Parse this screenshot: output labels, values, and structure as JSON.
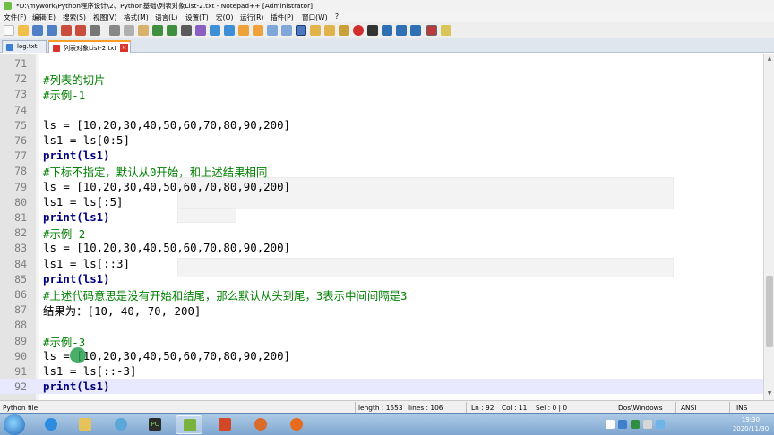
{
  "window": {
    "title": "*D:\\mywork\\Python程序设计\\2、Python基础\\列表对象List-2.txt - Notepad++ [Administrator]"
  },
  "menu": [
    "文件(F)",
    "编辑(E)",
    "搜索(S)",
    "视图(V)",
    "格式(M)",
    "语言(L)",
    "设置(T)",
    "宏(O)",
    "运行(R)",
    "插件(P)",
    "窗口(W)",
    "?"
  ],
  "tabs": [
    {
      "label": "log.txt",
      "active": false,
      "icon_color": "#3d7fd6"
    },
    {
      "label": "列表对象List-2.txt",
      "active": true,
      "icon_color": "#d9342b"
    }
  ],
  "editor": {
    "current_line": 92,
    "lines": [
      {
        "n": "71",
        "text": "",
        "style": "plain"
      },
      {
        "n": "72",
        "text": "#列表的切片",
        "style": "comment"
      },
      {
        "n": "73",
        "text": "#示例-1",
        "style": "comment"
      },
      {
        "n": "74",
        "text": "",
        "style": "plain"
      },
      {
        "n": "75",
        "text": "ls = [10,20,30,40,50,60,70,80,90,200]",
        "style": "plain"
      },
      {
        "n": "76",
        "text": "ls1 = ls[0:5]",
        "style": "plain"
      },
      {
        "n": "77",
        "text": "print(ls1)",
        "style": "kw"
      },
      {
        "n": "78",
        "text": "#下标不指定，默认从0开始，和上述结果相同",
        "style": "comment"
      },
      {
        "n": "79",
        "text": "ls = [10,20,30,40,50,60,70,80,90,200]",
        "style": "plain"
      },
      {
        "n": "80",
        "text": "ls1 = ls[:5]",
        "style": "plain"
      },
      {
        "n": "81",
        "text": "print(ls1)",
        "style": "kw"
      },
      {
        "n": "82",
        "text": "#示例-2",
        "style": "comment"
      },
      {
        "n": "83",
        "text": "ls = [10,20,30,40,50,60,70,80,90,200]",
        "style": "plain"
      },
      {
        "n": "84",
        "text": "ls1 = ls[::3]",
        "style": "plain"
      },
      {
        "n": "85",
        "text": "print(ls1)",
        "style": "kw"
      },
      {
        "n": "86",
        "text": "#上述代码意思是没有开始和结尾，那么默认从头到尾，3表示中间间隔是3",
        "style": "comment"
      },
      {
        "n": "87",
        "text": "结果为：[10, 40, 70, 200]",
        "style": "plain"
      },
      {
        "n": "88",
        "text": "",
        "style": "plain"
      },
      {
        "n": "89",
        "text": "#示例-3",
        "style": "comment"
      },
      {
        "n": "90",
        "text": "ls = [10,20,30,40,50,60,70,80,90,200]",
        "style": "plain"
      },
      {
        "n": "91",
        "text": "ls1 = ls[::-3]",
        "style": "plain"
      },
      {
        "n": "92",
        "text": "print(ls1)",
        "style": "kw"
      }
    ]
  },
  "status": {
    "file_type": "Python file",
    "length": "length : 1553",
    "lines": "lines : 106",
    "ln": "Ln : 92",
    "col": "Col : 11",
    "sel": "Sel : 0 | 0",
    "eol": "Dos\\Windows",
    "encoding": "ANSI",
    "mode": "INS"
  },
  "taskbar": {
    "apps": [
      {
        "name": "ie",
        "color": "#2d8be0"
      },
      {
        "name": "explorer",
        "color": "#e6c35a"
      },
      {
        "name": "app3",
        "color": "#5aa7d8"
      },
      {
        "name": "pycharm",
        "color": "#2b2b2b"
      },
      {
        "name": "notepad-plus-plus",
        "color": "#79b23d"
      },
      {
        "name": "powerpoint",
        "color": "#d24726"
      },
      {
        "name": "app7",
        "color": "#d96b2b"
      },
      {
        "name": "firefox",
        "color": "#e66b1f"
      }
    ],
    "clock_time": "19:30",
    "clock_date": "2020/11/30"
  }
}
